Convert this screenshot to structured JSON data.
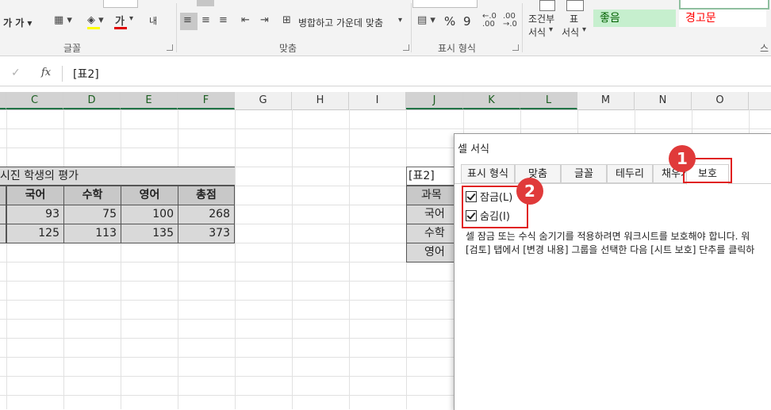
{
  "ribbon": {
    "row1_left": "가  가 ▾",
    "font_color_glyph": "가",
    "wrap_short": "내",
    "merge_label": "병합하고 가운데 맞춤",
    "percent": "%",
    "comma": "9",
    "cond_format_line1": "조건부",
    "cond_format_line2": "서식",
    "table_format_line1": "표",
    "table_format_line2": "서식",
    "style_good": "좋음",
    "style_warn": "경고문",
    "group_font": "글꼴",
    "group_align": "맞춤",
    "group_number": "표시 형식",
    "group_styles": "스",
    "colors": {
      "good_bg": "#c6efce",
      "good_fg": "#006100",
      "warn_fg": "#ff0000",
      "accent": "#217346"
    }
  },
  "formula_bar": {
    "cancel": "✓",
    "fx": "fx",
    "content": "[표2]"
  },
  "columns": [
    "C",
    "D",
    "E",
    "F",
    "G",
    "H",
    "I",
    "J",
    "K",
    "L",
    "M",
    "N",
    "O"
  ],
  "sheet": {
    "title": "시진 학생의 평가",
    "headers": [
      "국어",
      "수학",
      "영어",
      "총점"
    ],
    "rows": [
      [
        "93",
        "75",
        "100",
        "268"
      ],
      [
        "125",
        "113",
        "135",
        "373"
      ]
    ],
    "right_table": {
      "title": "[표2]",
      "cells": [
        "과목",
        "국어",
        "수학",
        "영어"
      ]
    }
  },
  "dialog": {
    "title": "셀 서식",
    "tabs": [
      "표시 형식",
      "맞춤",
      "글꼴",
      "테두리",
      "채우기",
      "보호"
    ],
    "active_tab": "보호",
    "lock_label": "잠금(L)",
    "hide_label": "숨김(I)",
    "desc_line1": "셀 잠금 또는 수식 숨기기를 적용하려면 워크시트를 보호해야 합니다. 워",
    "desc_line2": "[검토] 탭에서 [변경 내용] 그룹을 선택한 다음 [시트 보호] 단추를 클릭하"
  },
  "annotations": {
    "badge1": "1",
    "badge2": "2"
  }
}
